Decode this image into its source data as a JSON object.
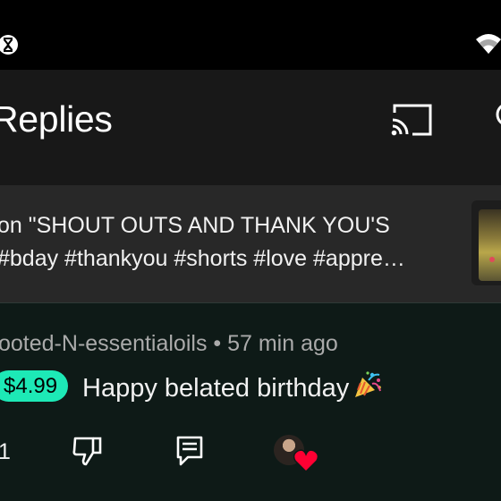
{
  "status_bar": {
    "left_icon": "hourglass-icon",
    "right_icon": "wifi-icon"
  },
  "header": {
    "title": "Replies",
    "cast_icon": "cast-icon",
    "search_icon": "search-icon"
  },
  "video_context": {
    "line1": "on \"SHOUT OUTS AND THANK YOU'S",
    "line2": "#bday #thankyou #shorts #love #appre…"
  },
  "comment": {
    "meta": "ooted-N-essentialoils • 57 min ago",
    "superchat_amount": "$4.99",
    "text": "Happy belated birthday",
    "emoji": "party-popper-icon",
    "like_count": "1",
    "colors": {
      "superchat_badge": "#1de9b6",
      "heart": "#ff0033"
    }
  }
}
